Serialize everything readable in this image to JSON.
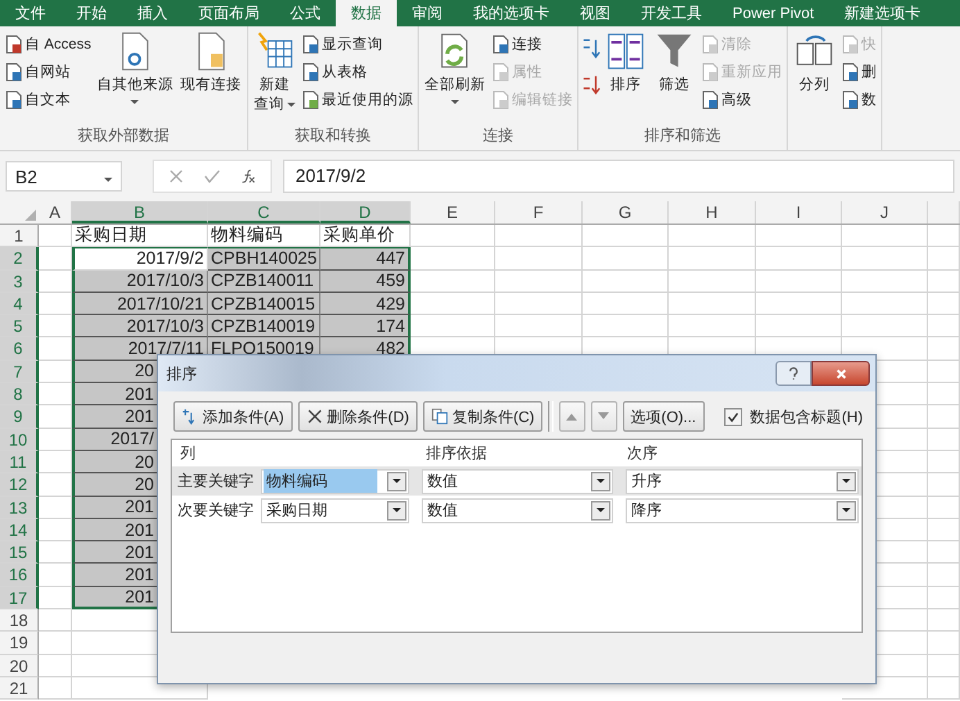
{
  "ribbon": {
    "tabs": [
      {
        "label": "文件",
        "selected": false
      },
      {
        "label": "开始",
        "selected": false
      },
      {
        "label": "插入",
        "selected": false
      },
      {
        "label": "页面布局",
        "selected": false
      },
      {
        "label": "公式",
        "selected": false
      },
      {
        "label": "数据",
        "selected": true
      },
      {
        "label": "审阅",
        "selected": false
      },
      {
        "label": "我的选项卡",
        "selected": false
      },
      {
        "label": "视图",
        "selected": false
      },
      {
        "label": "开发工具",
        "selected": false
      },
      {
        "label": "Power Pivot",
        "selected": false
      },
      {
        "label": "新建选项卡",
        "selected": false
      }
    ],
    "groups": [
      {
        "label": "获取外部数据",
        "items": [
          {
            "kind": "stack",
            "items": [
              {
                "label": "自 Access",
                "disabled": false
              },
              {
                "label": "自网站",
                "disabled": false
              },
              {
                "label": "自文本",
                "disabled": false
              }
            ]
          },
          {
            "kind": "large",
            "lines": [
              "自其他来源"
            ],
            "dropdown": true
          },
          {
            "kind": "large",
            "lines": [
              "现有连接"
            ],
            "dropdown": false
          }
        ]
      },
      {
        "label": "获取和转换",
        "items": [
          {
            "kind": "large",
            "lines": [
              "新建",
              "查询"
            ],
            "dropdown": true
          },
          {
            "kind": "stack",
            "items": [
              {
                "label": "显示查询",
                "disabled": false
              },
              {
                "label": "从表格",
                "disabled": false
              },
              {
                "label": "最近使用的源",
                "disabled": false
              }
            ]
          }
        ]
      },
      {
        "label": "连接",
        "items": [
          {
            "kind": "large",
            "lines": [
              "全部刷新"
            ],
            "dropdown": true
          },
          {
            "kind": "stack",
            "items": [
              {
                "label": "连接",
                "disabled": false
              },
              {
                "label": "属性",
                "disabled": true
              },
              {
                "label": "编辑链接",
                "disabled": true
              }
            ]
          }
        ]
      },
      {
        "label": "排序和筛选",
        "items": [
          {
            "kind": "sort-icons"
          },
          {
            "kind": "large",
            "lines": [
              "排序"
            ],
            "dropdown": false
          },
          {
            "kind": "large",
            "lines": [
              "筛选"
            ],
            "dropdown": false
          },
          {
            "kind": "stack",
            "items": [
              {
                "label": "清除",
                "disabled": true
              },
              {
                "label": "重新应用",
                "disabled": true
              },
              {
                "label": "高级",
                "disabled": false
              }
            ]
          }
        ]
      },
      {
        "items": [
          {
            "kind": "large",
            "lines": [
              "分列"
            ],
            "dropdown": false
          },
          {
            "kind": "stack",
            "items": [
              {
                "label": "快",
                "disabled": true
              },
              {
                "label": "删",
                "disabled": false
              },
              {
                "label": "数",
                "disabled": false
              }
            ]
          }
        ]
      }
    ]
  },
  "formula_bar": {
    "name_box": "B2",
    "value": "2017/9/2"
  },
  "sheet": {
    "columns": [
      {
        "label": "A",
        "selected": false
      },
      {
        "label": "B",
        "selected": true
      },
      {
        "label": "C",
        "selected": true
      },
      {
        "label": "D",
        "selected": true
      },
      {
        "label": "E",
        "selected": false
      },
      {
        "label": "F",
        "selected": false
      },
      {
        "label": "G",
        "selected": false
      },
      {
        "label": "H",
        "selected": false
      },
      {
        "label": "I",
        "selected": false
      },
      {
        "label": "J",
        "selected": false
      }
    ],
    "rows": [
      {
        "number": "1",
        "cells": [
          "采购日期",
          "物料编码",
          "采购单价"
        ],
        "selected": false,
        "active": false
      },
      {
        "number": "2",
        "cells": [
          "2017/9/2",
          "CPBH140025",
          "447"
        ],
        "selected": true,
        "active": true
      },
      {
        "number": "3",
        "cells": [
          "2017/10/3",
          "CPZB140011",
          "459"
        ],
        "selected": true,
        "active": false
      },
      {
        "number": "4",
        "cells": [
          "2017/10/21",
          "CPZB140015",
          "429"
        ],
        "selected": true,
        "active": false
      },
      {
        "number": "5",
        "cells": [
          "2017/10/3",
          "CPZB140019",
          "174"
        ],
        "selected": true,
        "active": false
      },
      {
        "number": "6",
        "cells": [
          "2017/7/11",
          "FLPO150019",
          "482"
        ],
        "selected": true,
        "active": false
      },
      {
        "number": "7",
        "cells": [
          "20"
        ],
        "selected": true,
        "active": false
      },
      {
        "number": "8",
        "cells": [
          "201"
        ],
        "selected": true,
        "active": false
      },
      {
        "number": "9",
        "cells": [
          "201"
        ],
        "selected": true,
        "active": false
      },
      {
        "number": "10",
        "cells": [
          "2017/"
        ],
        "selected": true,
        "active": false
      },
      {
        "number": "11",
        "cells": [
          "20"
        ],
        "selected": true,
        "active": false
      },
      {
        "number": "12",
        "cells": [
          "20"
        ],
        "selected": true,
        "active": false
      },
      {
        "number": "13",
        "cells": [
          "201"
        ],
        "selected": true,
        "active": false
      },
      {
        "number": "14",
        "cells": [
          "201"
        ],
        "selected": true,
        "active": false
      },
      {
        "number": "15",
        "cells": [
          "201"
        ],
        "selected": true,
        "active": false
      },
      {
        "number": "16",
        "cells": [
          "201"
        ],
        "selected": true,
        "active": false
      },
      {
        "number": "17",
        "cells": [
          "201"
        ],
        "selected": true,
        "active": false
      },
      {
        "number": "18",
        "selected": false,
        "active": false
      },
      {
        "number": "19",
        "selected": false,
        "active": false
      },
      {
        "number": "20",
        "selected": false,
        "active": false
      },
      {
        "number": "21",
        "selected": false,
        "active": false
      }
    ]
  },
  "dialog": {
    "title": "排序",
    "toolbar": [
      {
        "kind": "button",
        "label": "添加条件(A)",
        "disabled": false
      },
      {
        "kind": "button",
        "label": "删除条件(D)",
        "disabled": false
      },
      {
        "kind": "button",
        "label": "复制条件(C)",
        "disabled": false
      },
      {
        "kind": "arrow-up",
        "disabled": true
      },
      {
        "kind": "arrow-down",
        "disabled": true
      },
      {
        "kind": "button",
        "label": "选项(O)...",
        "disabled": false
      }
    ],
    "header_checkbox": {
      "label": "数据包含标题(H)",
      "checked": true
    },
    "columns": [
      "列",
      "排序依据",
      "次序"
    ],
    "levels": [
      {
        "label": "主要关键字",
        "column": "物料编码",
        "sort_on": "数值",
        "order": "升序",
        "selected": true
      },
      {
        "label": "次要关键字",
        "column": "采购日期",
        "sort_on": "数值",
        "order": "降序",
        "selected": false
      }
    ]
  }
}
